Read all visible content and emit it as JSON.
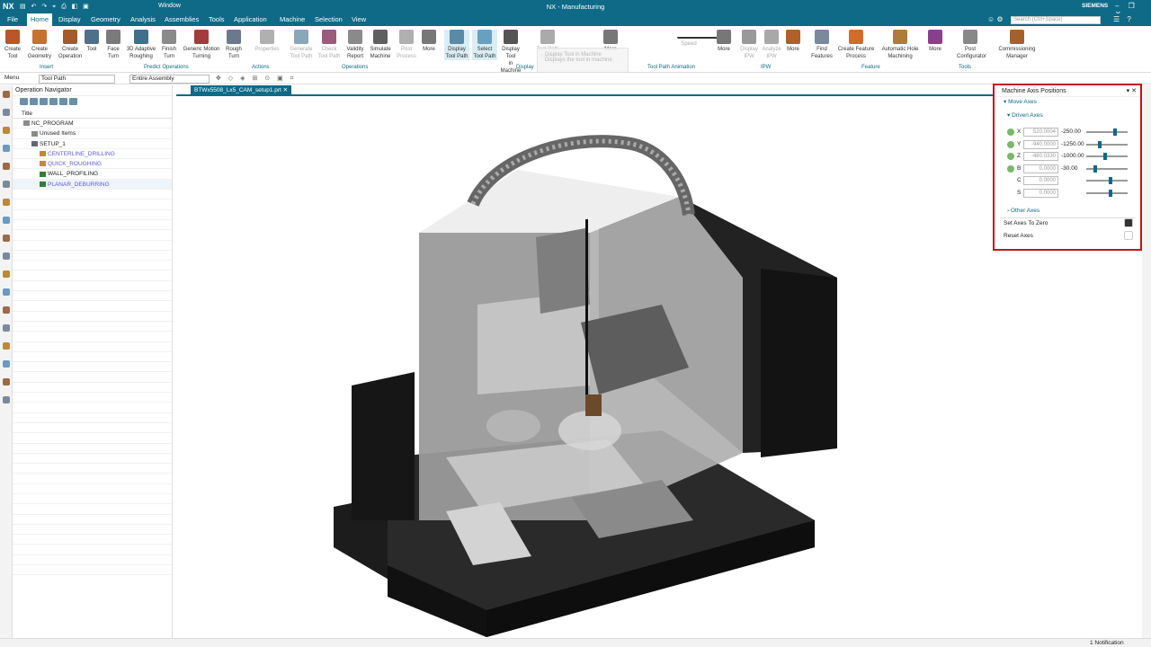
{
  "app": {
    "logo": "NX",
    "window_menu": "Window",
    "title": "NX - Manufacturing",
    "brand": "SIEMENS"
  },
  "menubar": {
    "tabs": [
      "File",
      "Home",
      "Display",
      "Geometry",
      "Analysis",
      "Assemblies",
      "Tools",
      "Application",
      "Machine",
      "Selection",
      "View"
    ],
    "active": "Home",
    "search_placeholder": "Search (Ctrl+Space)"
  },
  "ribbon": {
    "buttons": [
      {
        "label": "Create\nTool",
        "icon": "create-tool-icon"
      },
      {
        "label": "Create\nGeometry",
        "icon": "create-geometry-icon"
      },
      {
        "label": "Create\nOperation",
        "icon": "create-operation-icon"
      },
      {
        "label": "Tool",
        "icon": "tool-icon"
      },
      {
        "label": "Face\nTurn",
        "icon": "face-turn-icon"
      },
      {
        "label": "3D Adaptive\nRoughing",
        "icon": "adaptive-roughing-icon"
      },
      {
        "label": "Finish\nTurn",
        "icon": "finish-turn-icon"
      },
      {
        "label": "Generic Motion\nTurning",
        "icon": "generic-motion-icon"
      },
      {
        "label": "Rough\nTurn",
        "icon": "rough-turn-icon"
      },
      {
        "label": "Properties",
        "icon": "properties-icon"
      },
      {
        "label": "Generate\nTool Path",
        "icon": "generate-toolpath-icon"
      },
      {
        "label": "Check\nTool Path",
        "icon": "check-toolpath-icon"
      },
      {
        "label": "Validity\nReport",
        "icon": "validity-report-icon"
      },
      {
        "label": "Simulate\nMachine",
        "icon": "simulate-machine-icon"
      },
      {
        "label": "Post\nProcess",
        "icon": "post-process-icon"
      },
      {
        "label": "More",
        "icon": "more-icon"
      },
      {
        "label": "Display\nTool Path",
        "icon": "display-toolpath-icon"
      },
      {
        "label": "Select\nTool Path",
        "icon": "select-toolpath-icon"
      },
      {
        "label": "Display Tool\nin Machine",
        "icon": "display-tool-machine-icon"
      },
      {
        "label": "Tool Path\nReport",
        "icon": "toolpath-report-icon"
      },
      {
        "label": "More",
        "icon": "more-icon"
      },
      {
        "label": "Speed",
        "icon": "speed-slider-icon"
      },
      {
        "label": "More",
        "icon": "more-icon"
      },
      {
        "label": "Display\nIPW",
        "icon": "display-ipw-icon"
      },
      {
        "label": "Analyze\nIPW",
        "icon": "analyze-ipw-icon"
      },
      {
        "label": "More",
        "icon": "more-icon"
      },
      {
        "label": "Find\nFeatures",
        "icon": "find-features-icon"
      },
      {
        "label": "Create Feature\nProcess",
        "icon": "create-feature-process-icon"
      },
      {
        "label": "Automatic Hole\nMachining",
        "icon": "automatic-hole-icon"
      },
      {
        "label": "More",
        "icon": "more-icon"
      },
      {
        "label": "Post\nConfigurator",
        "icon": "post-configurator-icon"
      },
      {
        "label": "Commissioning\nManager",
        "icon": "commissioning-manager-icon"
      }
    ],
    "groups": [
      "Insert",
      "Predict Operations",
      "Actions",
      "Operations",
      "Display",
      "Tool Path Animation",
      "IPW",
      "Feature",
      "Tools"
    ],
    "tooltip": {
      "title": "Display Tool in Machine",
      "body": "Displays the tool in machine."
    }
  },
  "toolbar2": {
    "menu": "Menu",
    "filter": "Tool Path",
    "scope": "Entire Assembly"
  },
  "navigator": {
    "title": "Operation Navigator",
    "column": "Title",
    "rows": [
      {
        "label": "NC_PROGRAM",
        "indent": 0,
        "link": false
      },
      {
        "label": "Unused Items",
        "indent": 1,
        "link": false
      },
      {
        "label": "SETUP_1",
        "indent": 1,
        "link": false
      },
      {
        "label": "CENTERLINE_DRILLING",
        "indent": 2,
        "link": true
      },
      {
        "label": "QUICK_ROUGHING",
        "indent": 2,
        "link": true
      },
      {
        "label": "WALL_PROFILING",
        "indent": 2,
        "link": false
      },
      {
        "label": "PLANAR_DEBURRING",
        "indent": 2,
        "link": true
      }
    ]
  },
  "viewport": {
    "tab": "BTWx5508_Lx5_CAM_setup1.prt"
  },
  "axis_panel": {
    "title": "Machine Axis Positions",
    "move_axes": "Move Axes",
    "driven_axes": "Driven Axes",
    "axes": [
      {
        "name": "X",
        "value": "520.0004",
        "limit": "-250.00",
        "pos": 0.72,
        "hasdot": true
      },
      {
        "name": "Y",
        "value": "-940.0000",
        "limit": "-1250.00",
        "pos": 0.3,
        "hasdot": true
      },
      {
        "name": "Z",
        "value": "-480.0330",
        "limit": "-1000.00",
        "pos": 0.45,
        "hasdot": true
      },
      {
        "name": "B",
        "value": "0.0000",
        "limit": "-30.00",
        "pos": 0.2,
        "hasdot": true
      },
      {
        "name": "C",
        "value": "0.0000",
        "limit": "",
        "pos": 0.6,
        "hasdot": false
      },
      {
        "name": "S",
        "value": "0.0000",
        "limit": "",
        "pos": 0.6,
        "hasdot": false
      }
    ],
    "other_axes": "Other Axes",
    "set_zero": "Set Axes To Zero",
    "reset": "Reset Axes"
  },
  "status": {
    "notifications": "1 Notification"
  }
}
